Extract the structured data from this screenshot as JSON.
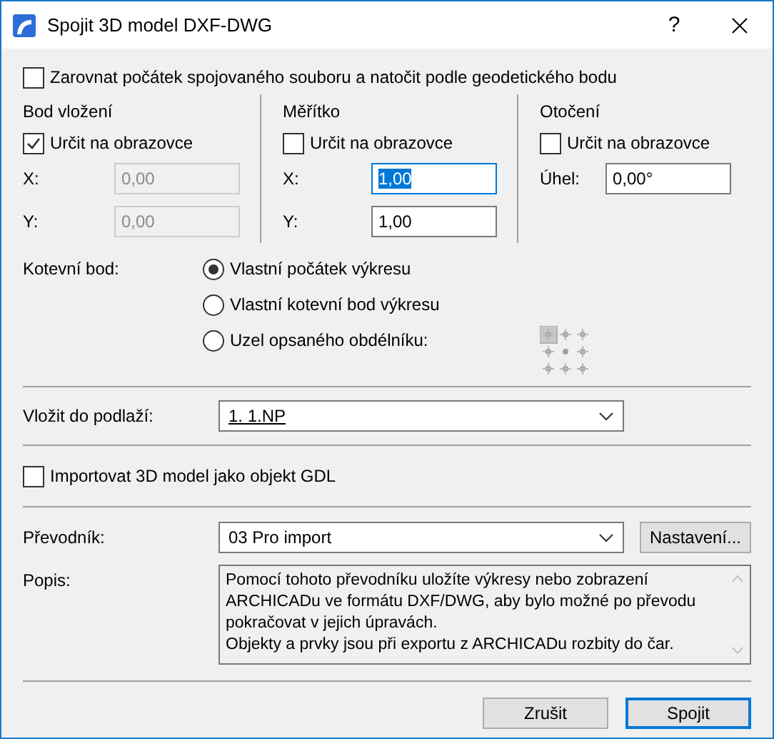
{
  "window": {
    "title": "Spojit 3D model DXF-DWG",
    "help": "?"
  },
  "align_checkbox": {
    "label": "Zarovnat počátek spojovaného souboru a natočit podle geodetického bodu",
    "checked": false
  },
  "columns": [
    {
      "heading": "Bod vložení",
      "checkbox": {
        "label": "Určit na obrazovce",
        "checked": true
      },
      "fields": [
        {
          "label": "X:",
          "value": "0,00",
          "disabled": true,
          "focused": false
        },
        {
          "label": "Y:",
          "value": "0,00",
          "disabled": true,
          "focused": false
        }
      ]
    },
    {
      "heading": "Měřítko",
      "checkbox": {
        "label": "Určit na obrazovce",
        "checked": false
      },
      "fields": [
        {
          "label": "X:",
          "value": "1,00",
          "disabled": false,
          "focused": true
        },
        {
          "label": "Y:",
          "value": "1,00",
          "disabled": false,
          "focused": false
        }
      ]
    },
    {
      "heading": "Otočení",
      "checkbox": {
        "label": "Určit na obrazovce",
        "checked": false
      },
      "fields": [
        {
          "label": "Úhel:",
          "value": "0,00°",
          "disabled": false,
          "focused": false
        }
      ]
    }
  ],
  "anchor": {
    "label": "Kotevní bod:",
    "options": [
      {
        "label": "Vlastní počátek výkresu",
        "selected": true
      },
      {
        "label": "Vlastní kotevní bod výkresu",
        "selected": false
      },
      {
        "label": "Uzel opsaného obdélníku:",
        "selected": false
      }
    ],
    "grid": [
      {
        "selected": true
      },
      {
        "selected": false
      },
      {
        "selected": false
      },
      {
        "selected": false
      },
      {
        "selected": false
      },
      {
        "selected": false
      },
      {
        "selected": false
      },
      {
        "selected": false
      },
      {
        "selected": false
      }
    ]
  },
  "story": {
    "label": "Vložit do podlaží:",
    "value": "1. 1.NP"
  },
  "gdl_checkbox": {
    "label": "Importovat 3D model jako objekt GDL",
    "checked": false
  },
  "translator": {
    "label": "Převodník:",
    "value": "03 Pro import",
    "settings_button": "Nastavení..."
  },
  "description": {
    "label": "Popis:",
    "lines": [
      "Pomocí tohoto převodníku uložíte výkresy nebo zobrazení",
      "ARCHICADu ve formátu DXF/DWG, aby bylo možné po převodu",
      "pokračovat v jejich úpravách.",
      "Objekty a prvky jsou při exportu z ARCHICADu rozbity do čar."
    ]
  },
  "buttons": [
    {
      "label": "Zrušit",
      "default": false
    },
    {
      "label": "Spojit",
      "default": true
    }
  ]
}
